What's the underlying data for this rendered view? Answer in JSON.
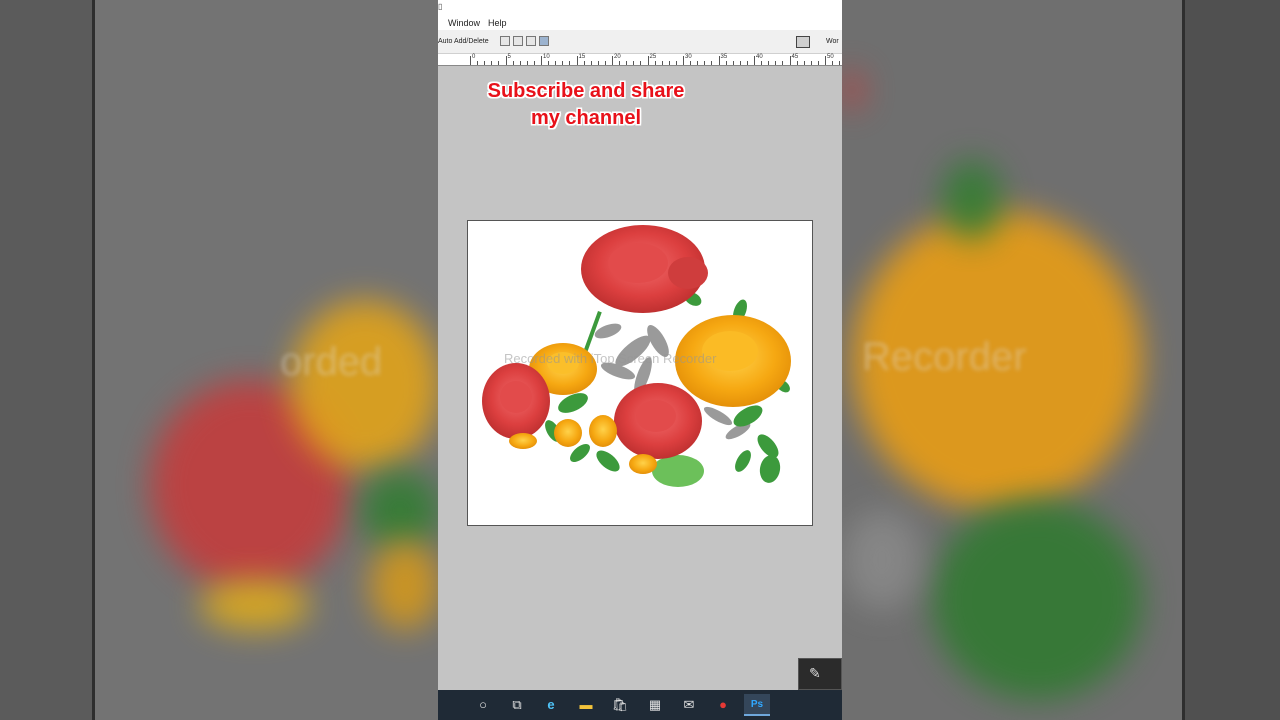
{
  "menu": {
    "items": [
      "Window",
      "Help"
    ]
  },
  "options_bar": {
    "auto_add_delete_label": "Auto Add/Delete",
    "workspace_label": "Wor"
  },
  "ruler": {
    "labels": [
      "0",
      "5",
      "10",
      "15",
      "20",
      "25",
      "30",
      "35",
      "40",
      "45",
      "50"
    ]
  },
  "overlay": {
    "line1": "Subscribe and share",
    "line2": "my channel"
  },
  "watermark": {
    "text": "Recorded with iTop Screen Recorder"
  },
  "side_watermark": {
    "left": "orded",
    "right": "Recorder"
  },
  "taskbar": {
    "items": [
      {
        "name": "search-icon",
        "glyph": "○"
      },
      {
        "name": "task-view-icon",
        "glyph": "⧉"
      },
      {
        "name": "edge-browser-icon",
        "glyph": "e"
      },
      {
        "name": "file-explorer-icon",
        "glyph": "▬"
      },
      {
        "name": "store-icon",
        "glyph": "🛍"
      },
      {
        "name": "calculator-icon",
        "glyph": "▦"
      },
      {
        "name": "mail-icon",
        "glyph": "✉"
      },
      {
        "name": "screen-recorder-icon",
        "glyph": "●"
      },
      {
        "name": "photoshop-icon",
        "glyph": "Ps"
      }
    ]
  },
  "colors": {
    "overlay_text": "#e8111a",
    "canvas_bg": "#ffffff",
    "workspace_bg": "#c4c4c4",
    "taskbar_bg": "#1f2a36"
  }
}
